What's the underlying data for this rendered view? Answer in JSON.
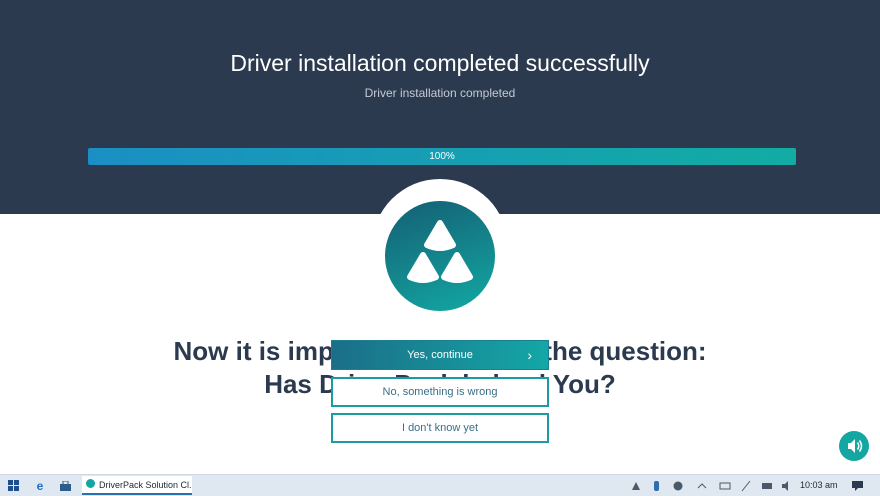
{
  "header": {
    "title": "Driver installation completed successfully",
    "subtitle": "Driver installation completed",
    "progress": {
      "label": "100%",
      "percent": 100
    }
  },
  "question": {
    "line1": "Now it is important to answer the question:",
    "line2": "Has DriverPack helped You?"
  },
  "buttons": {
    "yes": "Yes, continue",
    "yes_chevron": "›",
    "no": "No, something is wrong",
    "unknown": "I don't know yet"
  },
  "taskbar": {
    "app_label": "DriverPack Solution Cl...",
    "time": "10:03 am"
  },
  "colors": {
    "header_bg": "#2c3a4f",
    "accent": "#13a6a2",
    "progress_start": "#1b8fc4",
    "progress_end": "#12aca3"
  },
  "icons": [
    "driverpack-logo-icon",
    "speaker-icon",
    "windows-start-icon",
    "edge-browser-icon",
    "store-icon",
    "driverpack-app-icon",
    "system-tray-icons",
    "notification-icon"
  ]
}
